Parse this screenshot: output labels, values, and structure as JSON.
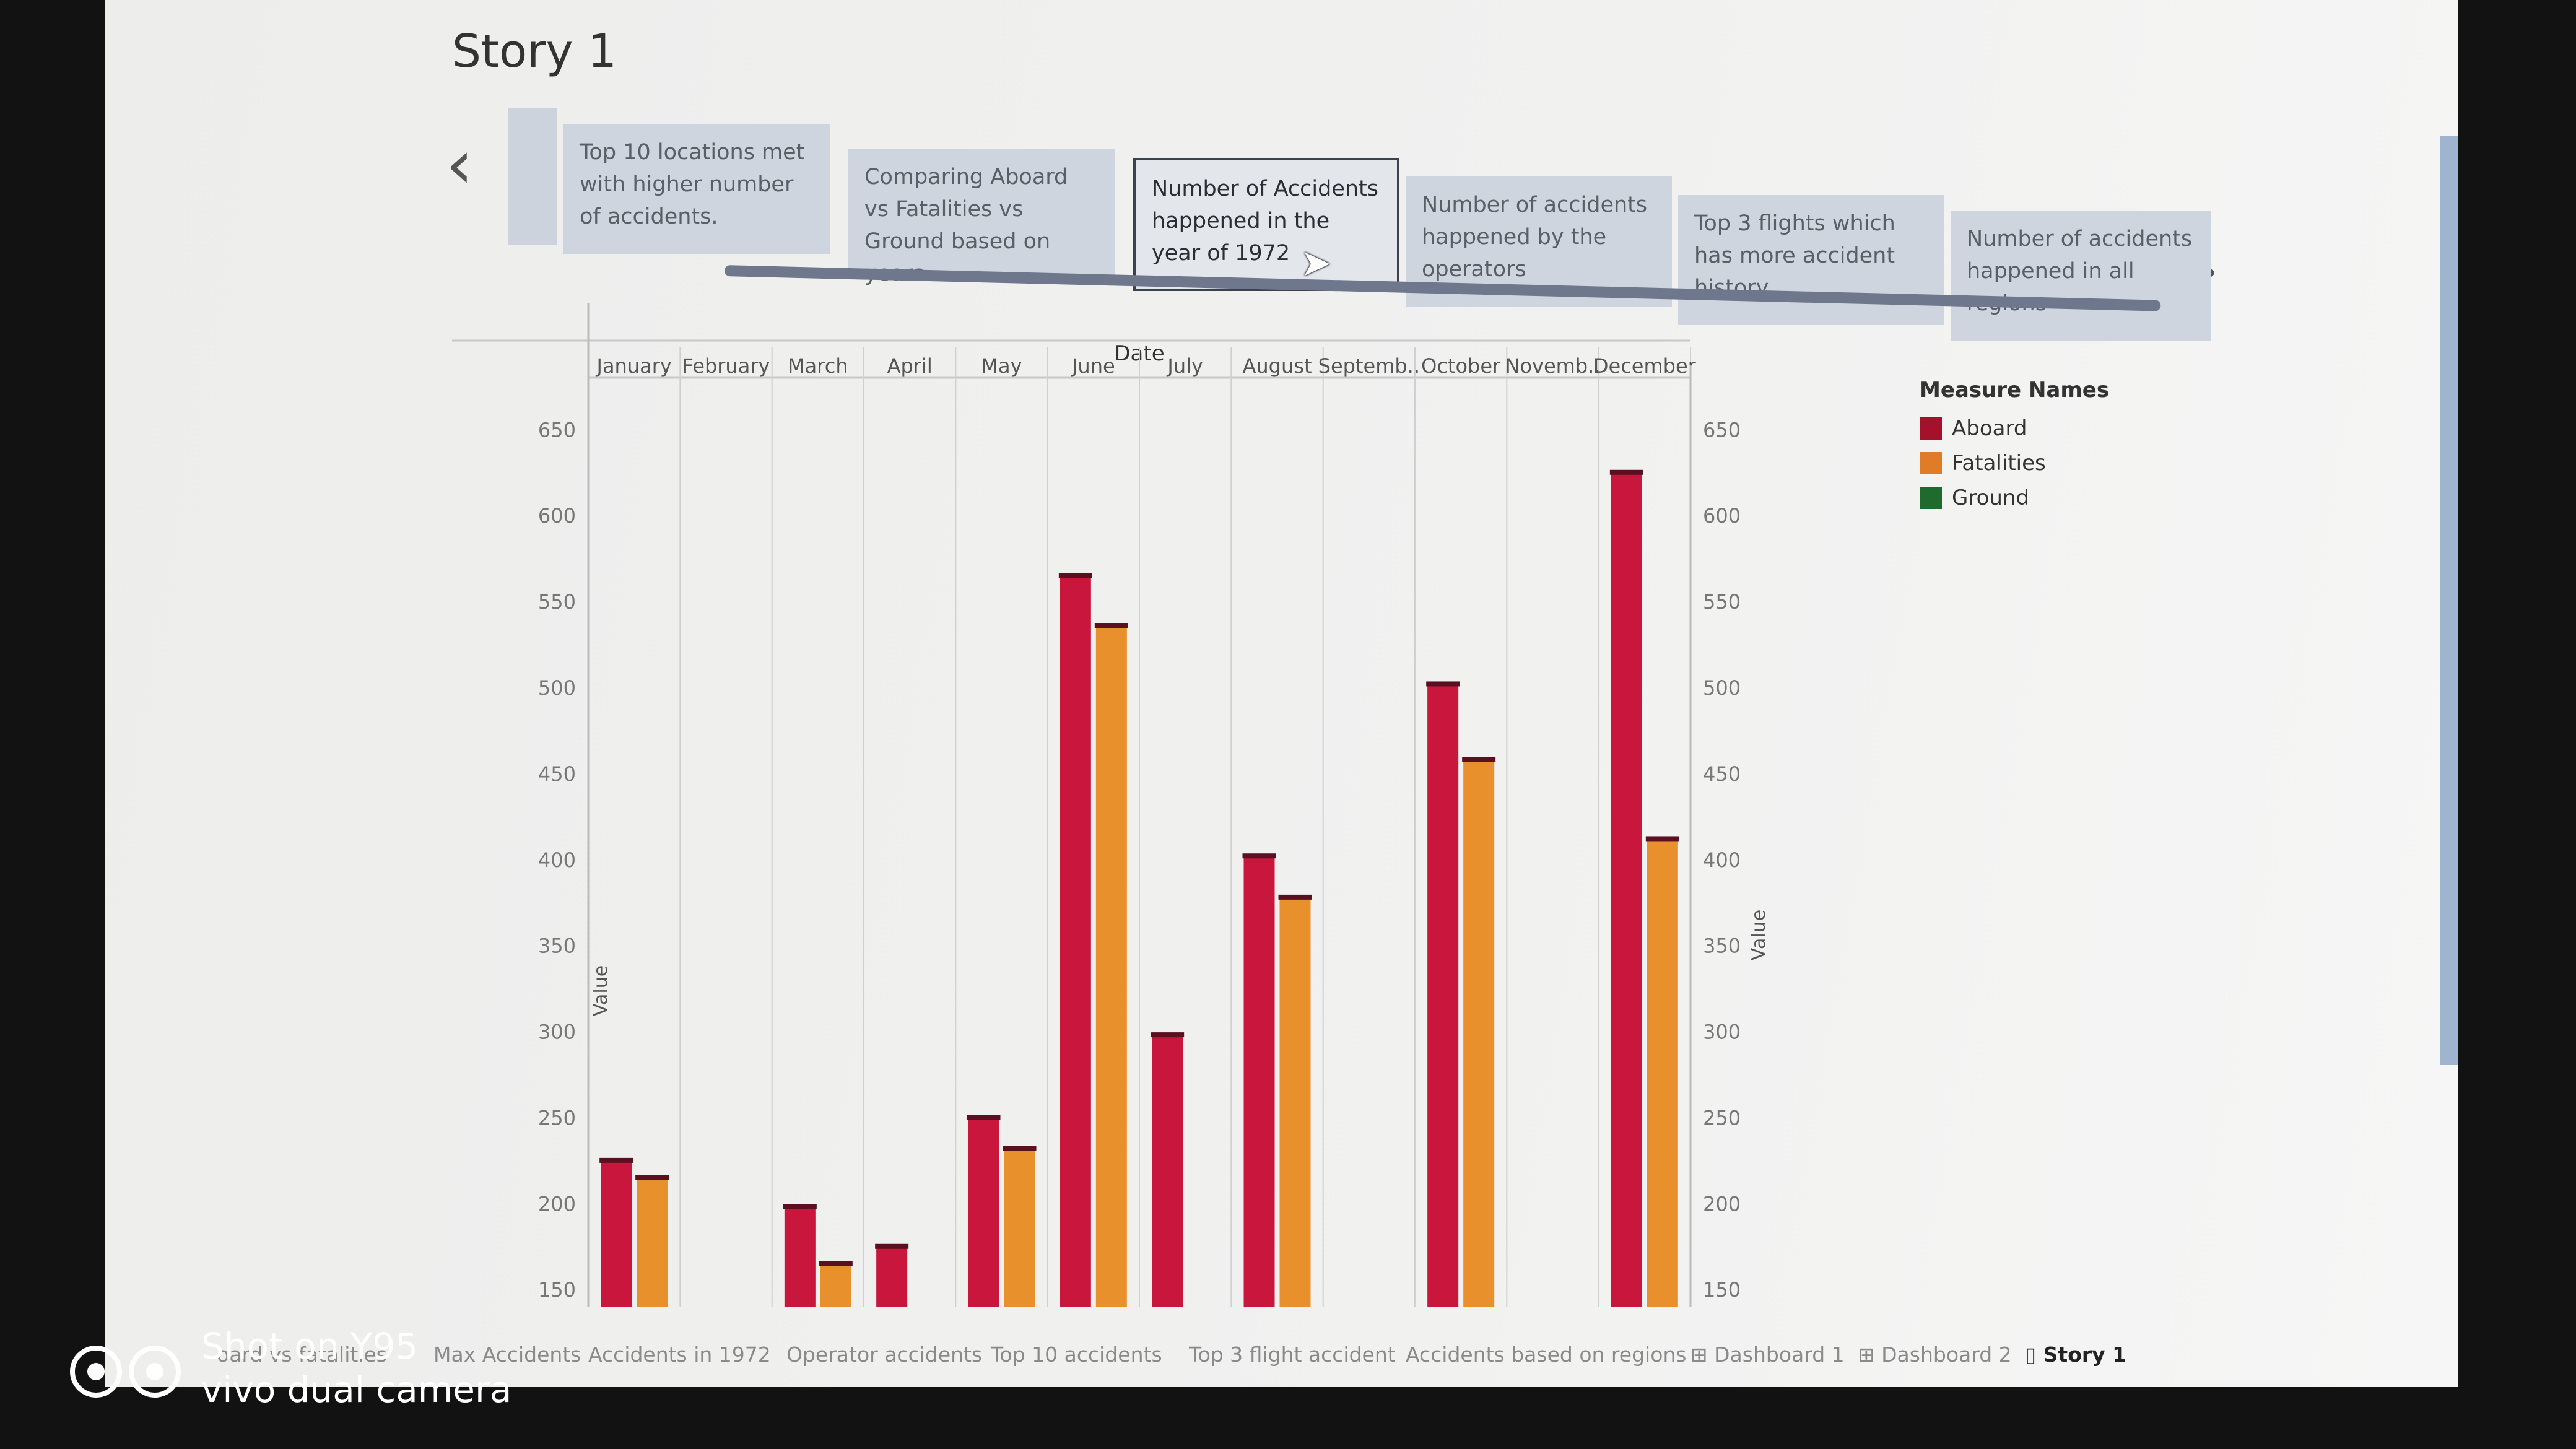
{
  "story_title": "Story 1",
  "nav": {
    "prev": "‹",
    "next": "›"
  },
  "story_points": [
    "Top 10 locations met with higher number of accidents.",
    "Comparing Aboard vs Fatalities vs Ground based on years",
    "Number of Accidents happened in the year of 1972",
    "Number of accidents happened by the operators",
    "Top 3 flights which has more accident history",
    "Number of accidents happened in all regions"
  ],
  "active_story_point": 2,
  "legend": {
    "title": "Measure Names",
    "items": [
      {
        "label": "Aboard",
        "color": "#a3122a"
      },
      {
        "label": "Fatalities",
        "color": "#e07b28"
      },
      {
        "label": "Ground",
        "color": "#1f6b2e"
      }
    ]
  },
  "chart_data": {
    "type": "bar",
    "title": "Date",
    "xlabel": "Date",
    "ylabel": "Value",
    "y2label": "Value",
    "ylim": [
      140,
      680
    ],
    "yticks": [
      150,
      200,
      250,
      300,
      350,
      400,
      450,
      500,
      550,
      600,
      650
    ],
    "categories": [
      "January",
      "February",
      "March",
      "April",
      "May",
      "June",
      "July",
      "August",
      "Septemb..",
      "October",
      "Novemb..",
      "December"
    ],
    "series": [
      {
        "name": "Aboard",
        "color": "#c8163c",
        "values": [
          225,
          null,
          198,
          175,
          250,
          565,
          298,
          402,
          null,
          502,
          null,
          625
        ]
      },
      {
        "name": "Fatalities",
        "color": "#e8912c",
        "values": [
          215,
          null,
          165,
          null,
          232,
          536,
          null,
          378,
          null,
          458,
          null,
          412
        ]
      },
      {
        "name": "Ground",
        "color": "#1f6b2e",
        "values": [
          null,
          null,
          null,
          null,
          null,
          null,
          null,
          null,
          null,
          null,
          null,
          null
        ]
      }
    ],
    "grid": true,
    "legend_position": "right"
  },
  "sheet_tabs": [
    "oard vs fatalities",
    "Max Accidents",
    "Accidents in 1972",
    "Operator accidents",
    "Top 10 accidents",
    "Top 3 flight accident",
    "Accidents based on regions",
    "Dashboard 1",
    "Dashboard 2",
    "Story 1"
  ],
  "active_sheet_tab": "Story 1",
  "camera": {
    "line1": "Shot on Y95",
    "line2": "vivo dual camera"
  }
}
